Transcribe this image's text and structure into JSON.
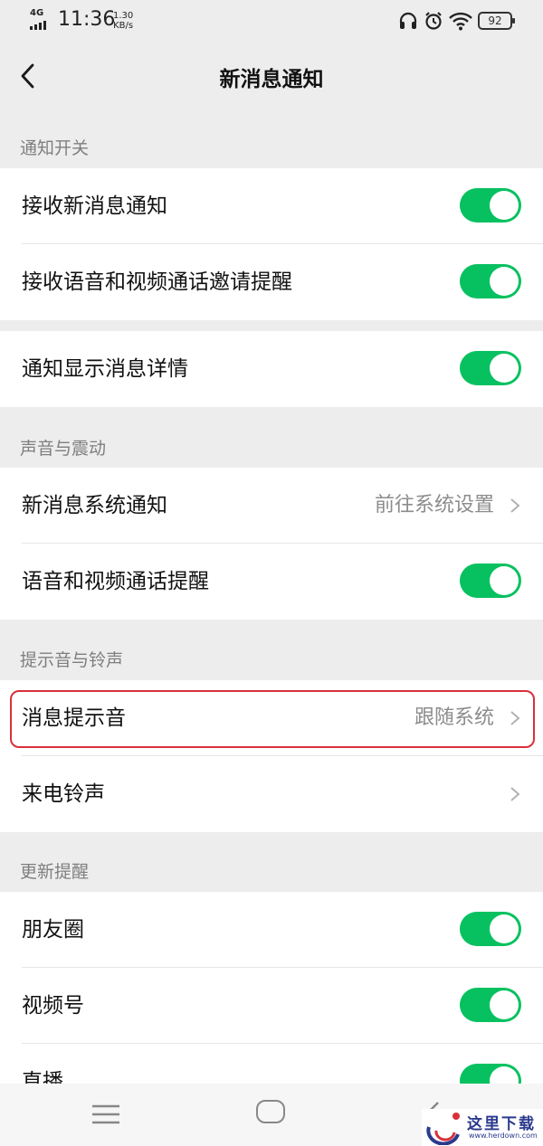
{
  "status_bar": {
    "network": "4G",
    "time": "11:36",
    "speed_value": "1.30",
    "speed_unit": "KB/s",
    "battery": "92",
    "icons": [
      "headphones-icon",
      "alarm-icon",
      "wifi-icon",
      "battery-icon"
    ]
  },
  "header": {
    "title": "新消息通知",
    "back_icon": "chevron-left-icon"
  },
  "sections": {
    "notify_switch": {
      "label": "通知开关",
      "rows": [
        {
          "label": "接收新消息通知",
          "toggle": true
        },
        {
          "label": "接收语音和视频通话邀请提醒",
          "toggle": true
        }
      ]
    },
    "detail": {
      "rows": [
        {
          "label": "通知显示消息详情",
          "toggle": true
        }
      ]
    },
    "sound": {
      "label": "声音与震动",
      "rows": [
        {
          "label": "新消息系统通知",
          "value": "前往系统设置"
        },
        {
          "label": "语音和视频通话提醒",
          "toggle": true
        }
      ]
    },
    "ringtone": {
      "label": "提示音与铃声",
      "rows": [
        {
          "label": "消息提示音",
          "value": "跟随系统",
          "highlighted": true
        },
        {
          "label": "来电铃声",
          "value": ""
        }
      ]
    },
    "updates": {
      "label": "更新提醒",
      "rows": [
        {
          "label": "朋友圈",
          "toggle": true
        },
        {
          "label": "视频号",
          "toggle": true
        },
        {
          "label": "直播",
          "toggle": true
        }
      ]
    }
  },
  "nav": {
    "icons": [
      "menu-icon",
      "home-icon",
      "back-icon"
    ]
  },
  "watermark": {
    "text": "这里下载",
    "url": "www.herdown.com"
  },
  "colors": {
    "toggle_on": "#07c160",
    "highlight": "#d8313a",
    "background": "#ededed"
  }
}
